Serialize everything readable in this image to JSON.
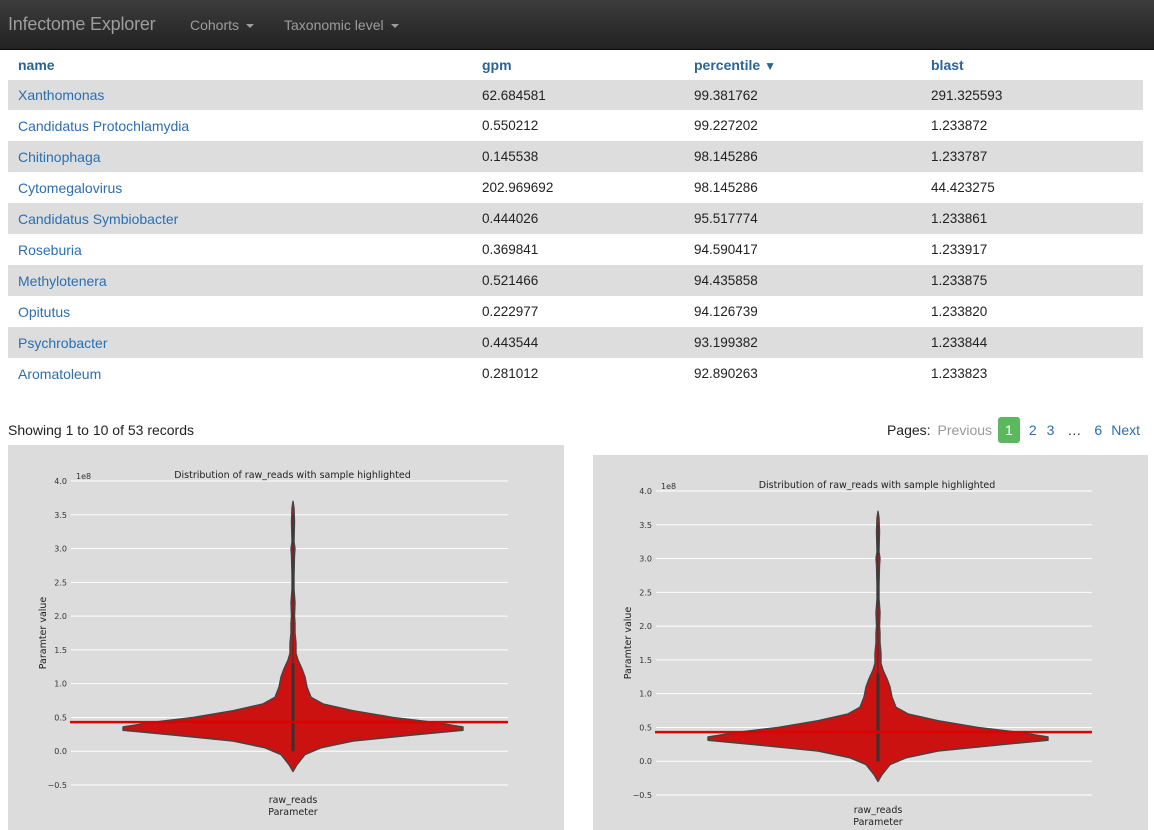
{
  "navbar": {
    "brand": "Infectome Explorer",
    "menus": [
      {
        "label": "Cohorts"
      },
      {
        "label": "Taxonomic level"
      }
    ]
  },
  "table": {
    "columns": [
      {
        "label": "name"
      },
      {
        "label": "gpm"
      },
      {
        "label": "percentile",
        "sort_icon": "▼"
      },
      {
        "label": "blast"
      }
    ],
    "rows": [
      {
        "name": "Xanthomonas",
        "gpm": "62.684581",
        "percentile": "99.381762",
        "blast": "291.325593"
      },
      {
        "name": "Candidatus Protochlamydia",
        "gpm": "0.550212",
        "percentile": "99.227202",
        "blast": "1.233872"
      },
      {
        "name": "Chitinophaga",
        "gpm": "0.145538",
        "percentile": "98.145286",
        "blast": "1.233787"
      },
      {
        "name": "Cytomegalovirus",
        "gpm": "202.969692",
        "percentile": "98.145286",
        "blast": "44.423275"
      },
      {
        "name": "Candidatus Symbiobacter",
        "gpm": "0.444026",
        "percentile": "95.517774",
        "blast": "1.233861"
      },
      {
        "name": "Roseburia",
        "gpm": "0.369841",
        "percentile": "94.590417",
        "blast": "1.233917"
      },
      {
        "name": "Methylotenera",
        "gpm": "0.521466",
        "percentile": "94.435858",
        "blast": "1.233875"
      },
      {
        "name": "Opitutus",
        "gpm": "0.222977",
        "percentile": "94.126739",
        "blast": "1.233820"
      },
      {
        "name": "Psychrobacter",
        "gpm": "0.443544",
        "percentile": "93.199382",
        "blast": "1.233844"
      },
      {
        "name": "Aromatoleum",
        "gpm": "0.281012",
        "percentile": "92.890263",
        "blast": "1.233823"
      }
    ]
  },
  "summary": "Showing 1 to 10 of 53 records",
  "pagination": {
    "label": "Pages:",
    "previous": "Previous",
    "pages": [
      "1",
      "2",
      "3"
    ],
    "ellipsis": "…",
    "last": "6",
    "next": "Next",
    "active": "1"
  },
  "chart_data": [
    {
      "type": "violin",
      "title": "Distribution of raw_reads with sample highlighted",
      "xlabel": "Parameter",
      "ylabel": "Paramter value",
      "category": "raw_reads",
      "scale_label": "1e8",
      "ylim": [
        -0.5,
        4.0
      ],
      "yticks": [
        "4.0",
        "3.5",
        "3.0",
        "2.5",
        "2.0",
        "1.5",
        "1.0",
        "0.5",
        "0.0",
        "−0.5"
      ],
      "grid": true,
      "highlight_value": 0.43,
      "data_range": [
        -0.3,
        3.7
      ],
      "violin_color": "#cc1111",
      "highlight_color": "#dd0000"
    },
    {
      "type": "violin",
      "title": "Distribution of raw_reads with sample highlighted",
      "xlabel": "Parameter",
      "ylabel": "Paramter value",
      "category": "raw_reads",
      "scale_label": "1e8",
      "ylim": [
        -0.5,
        4.0
      ],
      "yticks": [
        "4.0",
        "3.5",
        "3.0",
        "2.5",
        "2.0",
        "1.5",
        "1.0",
        "0.5",
        "0.0",
        "−0.5"
      ],
      "grid": true,
      "highlight_value": 0.43,
      "data_range": [
        -0.3,
        3.7
      ],
      "violin_color": "#cc1111",
      "highlight_color": "#dd0000"
    }
  ]
}
